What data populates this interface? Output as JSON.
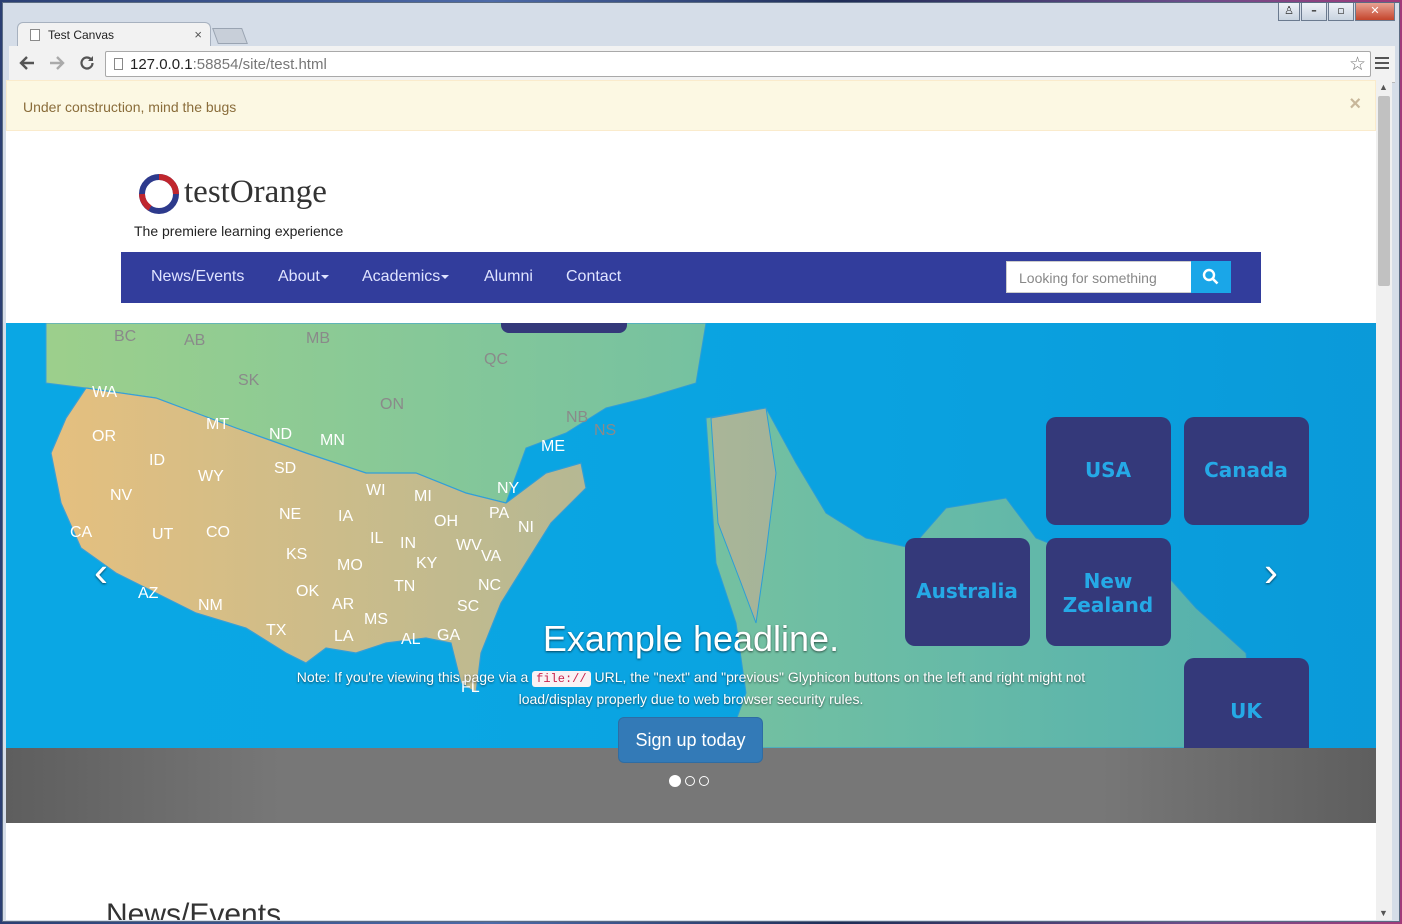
{
  "browser": {
    "tab_title": "Test Canvas",
    "tab_close": "×",
    "url_host": "127.0.0.1",
    "url_rest": ":58854/site/test.html",
    "back_icon": "arrow-left",
    "forward_icon": "arrow-right",
    "reload_icon": "reload",
    "bookmark_icon": "star-outline",
    "menu_icon": "hamburger"
  },
  "alert": {
    "text": "Under construction, mind the bugs",
    "close": "×"
  },
  "site": {
    "logo_text": "testOrange",
    "tagline": "The premiere learning experience",
    "nav": [
      {
        "label": "News/Events",
        "dropdown": false
      },
      {
        "label": "About",
        "dropdown": true
      },
      {
        "label": "Academics",
        "dropdown": true
      },
      {
        "label": "Alumni",
        "dropdown": false
      },
      {
        "label": "Contact",
        "dropdown": false
      }
    ],
    "search_placeholder": "Looking for something",
    "search_icon": "magnifier"
  },
  "map": {
    "state_labels": [
      "BC",
      "AB",
      "SK",
      "MB",
      "ON",
      "QC",
      "NB",
      "NS",
      "WA",
      "OR",
      "MT",
      "ND",
      "MN",
      "ID",
      "WY",
      "SD",
      "ME",
      "NV",
      "CA",
      "UT",
      "CO",
      "NE",
      "IA",
      "WI",
      "MI",
      "NY",
      "PA",
      "NI",
      "IL",
      "IN",
      "OH",
      "WV",
      "VA",
      "KS",
      "MO",
      "KY",
      "AZ",
      "NM",
      "OK",
      "AR",
      "TN",
      "NC",
      "TX",
      "LA",
      "MS",
      "AL",
      "GA",
      "SC",
      "FL"
    ],
    "tiles": [
      "USA",
      "Canada",
      "Australia",
      "New Zealand",
      "UK"
    ]
  },
  "carousel": {
    "prev_icon": "chevron-left",
    "next_icon": "chevron-right",
    "headline": "Example headline.",
    "note_before": "Note: If you're viewing this page via a",
    "note_code": "file://",
    "note_after": "URL, the \"next\" and \"previous\" Glyphicon buttons on the left and right might not load/display properly due to web browser security rules.",
    "button": "Sign up today",
    "slides": 3,
    "active_slide": 1
  },
  "section": {
    "title": "News/Events"
  },
  "colors": {
    "navbar": "#323d9c",
    "search_button": "#1aa6e8",
    "alert_bg": "#fcf8e3",
    "map_ocean": "#0aa7e4",
    "map_land": "#9fd08a",
    "map_us": "#e9c07d",
    "tile": "#34397a",
    "tile_text": "#25a9e6",
    "button": "#337ab7"
  }
}
